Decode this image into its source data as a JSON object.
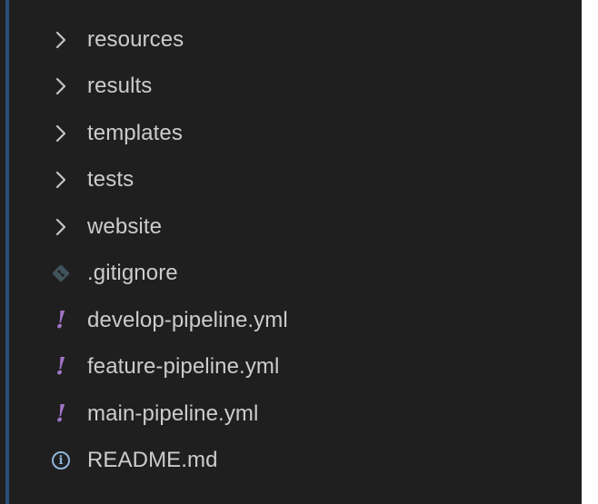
{
  "explorer": {
    "items": [
      {
        "label": "resources",
        "type": "folder",
        "icon": "chevron-right-icon"
      },
      {
        "label": "results",
        "type": "folder",
        "icon": "chevron-right-icon"
      },
      {
        "label": "templates",
        "type": "folder",
        "icon": "chevron-right-icon"
      },
      {
        "label": "tests",
        "type": "folder",
        "icon": "chevron-right-icon"
      },
      {
        "label": "website",
        "type": "folder",
        "icon": "chevron-right-icon"
      },
      {
        "label": ".gitignore",
        "type": "file",
        "icon": "git-icon"
      },
      {
        "label": "develop-pipeline.yml",
        "type": "file",
        "icon": "yaml-icon"
      },
      {
        "label": "feature-pipeline.yml",
        "type": "file",
        "icon": "yaml-icon"
      },
      {
        "label": "main-pipeline.yml",
        "type": "file",
        "icon": "yaml-icon"
      },
      {
        "label": "README.md",
        "type": "file",
        "icon": "info-icon"
      }
    ]
  },
  "colors": {
    "background": "#1f1f1f",
    "text": "#cccccc",
    "chevron": "#c5c5c5",
    "yaml_icon": "#a074c4",
    "git_icon": "#41535b",
    "info_icon": "#8fb4d8",
    "indent_rail": "#2b4f7a"
  }
}
